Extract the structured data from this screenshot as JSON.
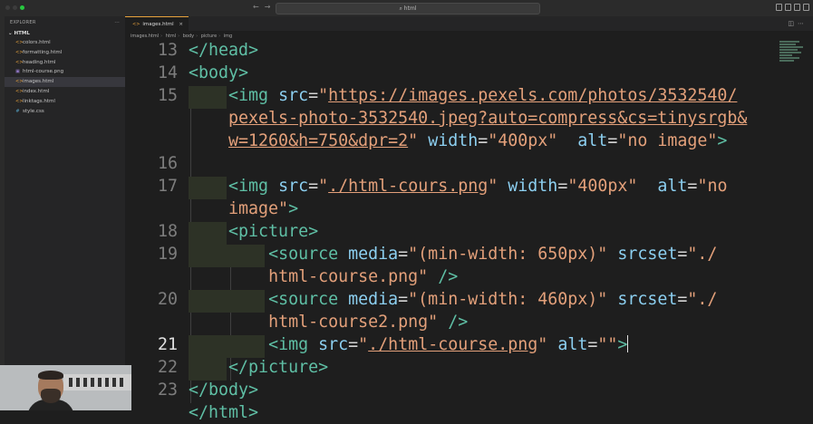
{
  "titlebar": {
    "search_text": "html",
    "nav_back": "←",
    "nav_forward": "→",
    "traffic_colors": [
      "#3c3c3c",
      "#3c3c3c",
      "#27c93f"
    ]
  },
  "sidebar": {
    "header": "EXPLORER",
    "more": "···",
    "folder": "HTML",
    "files": [
      {
        "name": "colors.html",
        "icon": "<>",
        "icon_color": "#e8a33d"
      },
      {
        "name": "formatting.html",
        "icon": "<>",
        "icon_color": "#e8a33d"
      },
      {
        "name": "heading.html",
        "icon": "<>",
        "icon_color": "#e8a33d"
      },
      {
        "name": "html-course.png",
        "icon": "▣",
        "icon_color": "#9b7fd4"
      },
      {
        "name": "images.html",
        "icon": "<>",
        "icon_color": "#e8a33d"
      },
      {
        "name": "index.html",
        "icon": "<>",
        "icon_color": "#e8a33d"
      },
      {
        "name": "linktags.html",
        "icon": "<>",
        "icon_color": "#e8a33d"
      },
      {
        "name": "style.css",
        "icon": "#",
        "icon_color": "#519aba"
      }
    ],
    "active_index": 4
  },
  "tab": {
    "label": "images.html",
    "close": "×"
  },
  "breadcrumb": [
    "images.html",
    "html",
    "body",
    "picture",
    "img"
  ],
  "editor": {
    "current_line": "21",
    "line_numbers": [
      "13",
      "14",
      "15",
      "",
      "",
      "16",
      "17",
      "",
      "18",
      "19",
      "",
      "20",
      "",
      "21",
      "22",
      "23",
      ""
    ]
  },
  "colors": {
    "tag": "#5fbfa5",
    "attribute": "#8ccff0",
    "string": "#e3a07a",
    "background": "#1e1e1e"
  }
}
